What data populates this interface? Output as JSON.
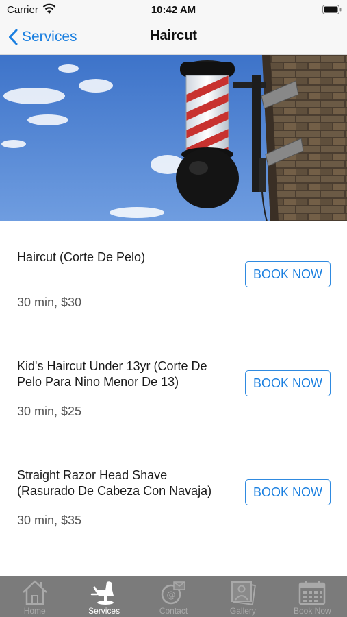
{
  "status_bar": {
    "carrier": "Carrier",
    "time": "10:42 AM"
  },
  "nav": {
    "back_label": "Services",
    "title": "Haircut"
  },
  "services": [
    {
      "name": "Haircut (Corte De Pelo)",
      "meta": "30 min, $30",
      "button": "BOOK NOW"
    },
    {
      "name": "Kid's Haircut Under 13yr  (Corte De Pelo Para Nino Menor De 13)",
      "meta": "30 min, $25",
      "button": "BOOK NOW"
    },
    {
      "name": "Straight Razor Head Shave (Rasurado De Cabeza Con Navaja)",
      "meta": "30 min, $35",
      "button": "BOOK NOW"
    }
  ],
  "tabs": [
    {
      "label": "Home",
      "icon": "home-icon",
      "active": false
    },
    {
      "label": "Services",
      "icon": "barber-chair-icon",
      "active": true
    },
    {
      "label": "Contact",
      "icon": "contact-icon",
      "active": false
    },
    {
      "label": "Gallery",
      "icon": "gallery-icon",
      "active": false
    },
    {
      "label": "Book Now",
      "icon": "calendar-icon",
      "active": false
    }
  ],
  "colors": {
    "accent": "#1a7fe0",
    "tab_bar": "#7b7b7b",
    "tab_active": "#ffffff",
    "tab_inactive": "#aaaaaa"
  }
}
